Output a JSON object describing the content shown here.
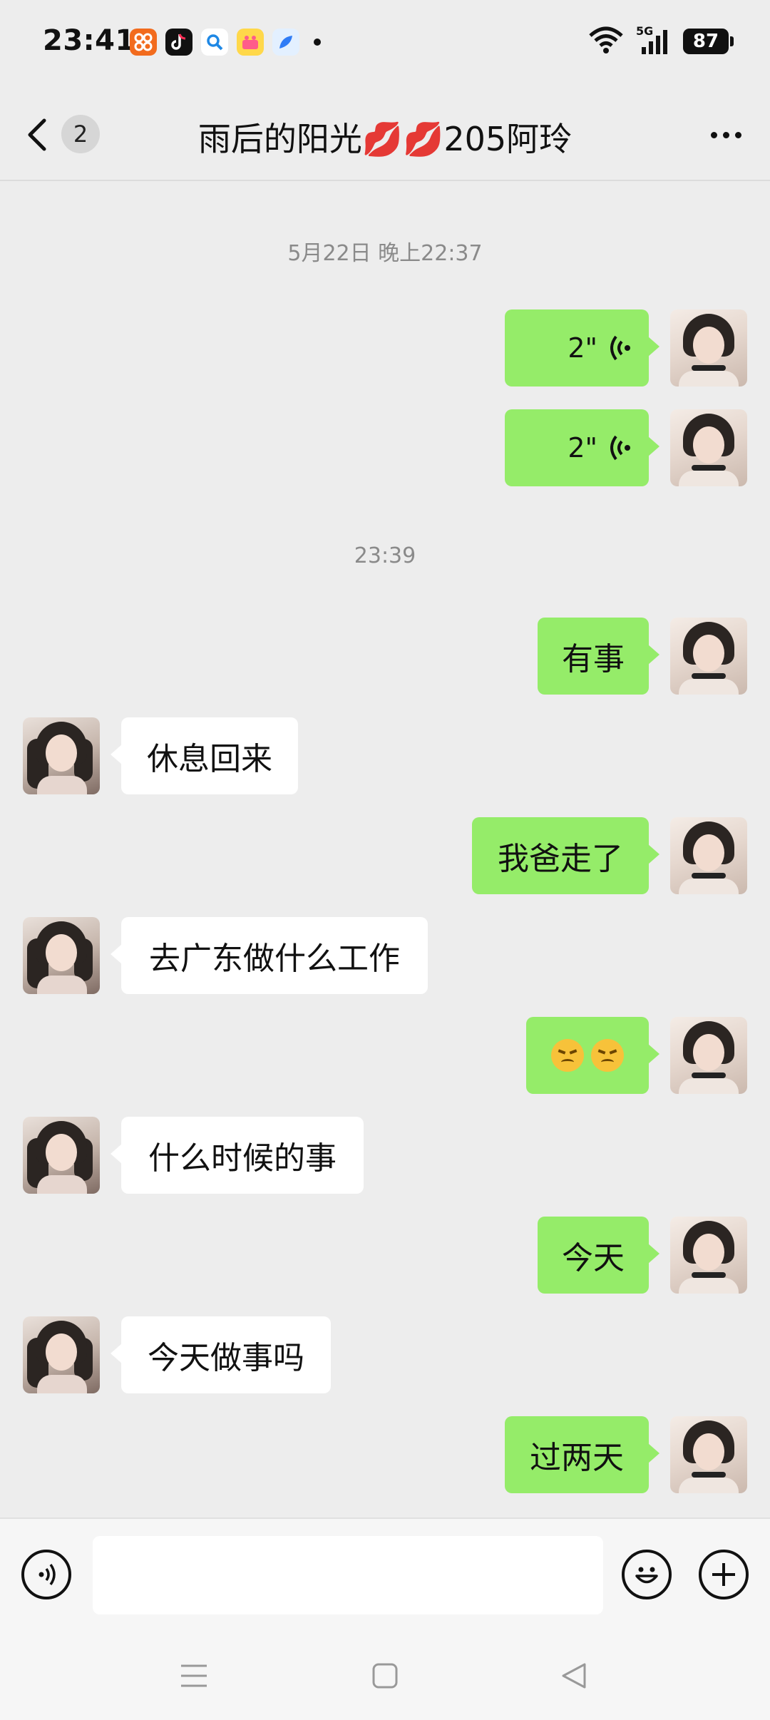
{
  "status_bar": {
    "time": "23:41",
    "network": "5G",
    "battery": "87",
    "app_icons": [
      "app-grid-icon",
      "tiktok-icon",
      "search-app-icon",
      "cake-app-icon",
      "feather-app-icon"
    ]
  },
  "header": {
    "unread_count": "2",
    "title": "雨后的阳光💋💋205阿玲"
  },
  "timestamps": [
    "5月22日 晚上22:37",
    "23:39"
  ],
  "messages": [
    {
      "side": "me",
      "type": "voice",
      "duration": "2\""
    },
    {
      "side": "me",
      "type": "voice",
      "duration": "2\""
    },
    {
      "side": "me",
      "type": "text",
      "text": "有事"
    },
    {
      "side": "other",
      "type": "text",
      "text": "休息回来"
    },
    {
      "side": "me",
      "type": "text",
      "text": "我爸走了"
    },
    {
      "side": "other",
      "type": "text",
      "text": "去广东做什么工作"
    },
    {
      "side": "me",
      "type": "emoji",
      "emoji_name": "tears-emoji",
      "count": 2
    },
    {
      "side": "other",
      "type": "text",
      "text": "什么时候的事"
    },
    {
      "side": "me",
      "type": "text",
      "text": "今天"
    },
    {
      "side": "other",
      "type": "text",
      "text": "今天做事吗"
    },
    {
      "side": "me",
      "type": "text",
      "text": "过两天"
    }
  ],
  "input_bar": {
    "value": "",
    "icons": [
      "voice-input-icon",
      "emoji-icon",
      "plus-icon"
    ]
  },
  "system_nav": [
    "menu-icon",
    "home-icon",
    "back-icon"
  ],
  "colors": {
    "background": "#ededed",
    "my_bubble": "#95ec69",
    "their_bubble": "#ffffff",
    "timestamp": "#8a8a8a"
  }
}
